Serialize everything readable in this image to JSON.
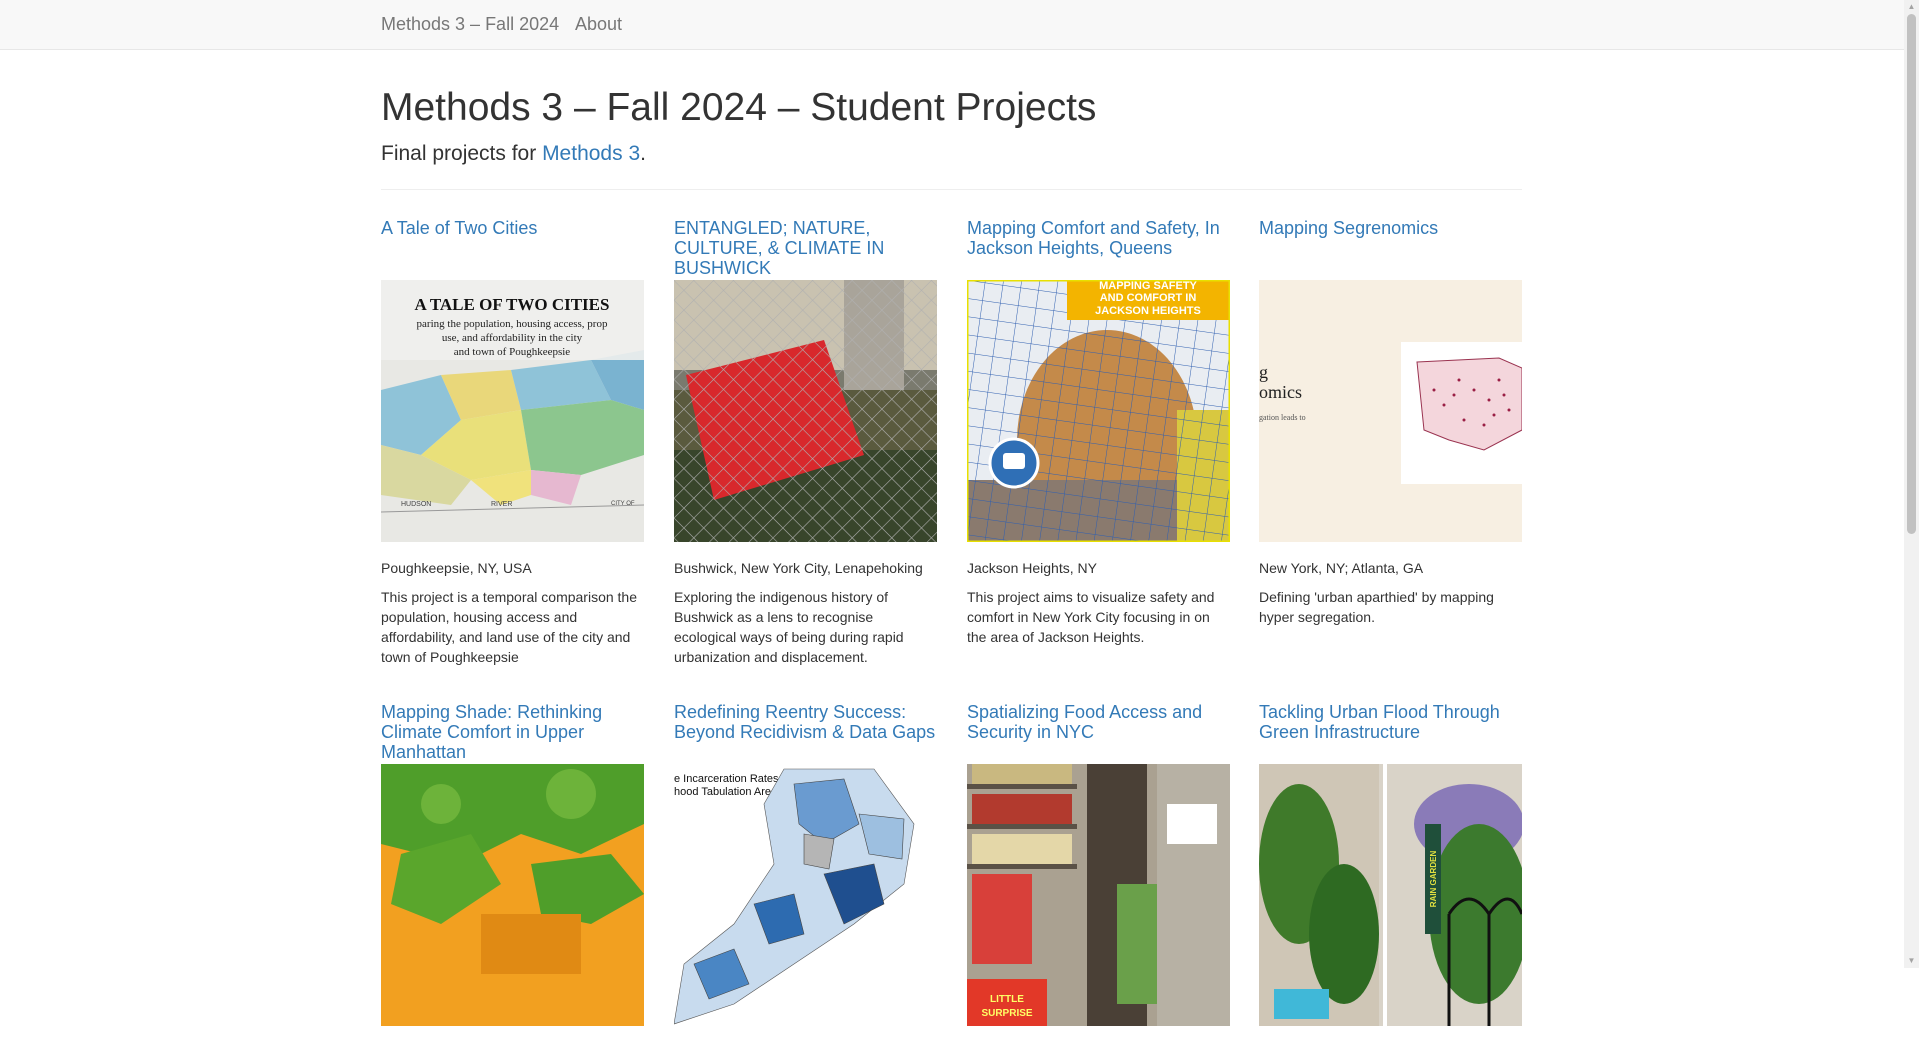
{
  "nav": {
    "brand": "Methods 3 – Fall 2024",
    "about": "About"
  },
  "header": {
    "title": "Methods 3 – Fall 2024 – Student Projects",
    "lead_prefix": "Final projects for ",
    "lead_link": "Methods 3",
    "lead_suffix": "."
  },
  "projects": [
    {
      "title": "A Tale of Two Cities",
      "location": "Poughkeepsie, NY, USA",
      "description": "This project is a temporal comparison the population, housing access and affordability, and land use of the city and town of Poughkeepsie",
      "image": {
        "heading": "A TALE OF TWO CITIES",
        "sub1": "paring the population, housing access, prop",
        "sub2": "use, and affordability in the city",
        "sub3": "and town of Poughkeepsie",
        "map_label1": "HUDSON",
        "map_label2": "RIVER",
        "map_label3": "CITY OF"
      }
    },
    {
      "title": "ENTANGLED; NATURE, CULTURE, & CLIMATE IN BUSHWICK",
      "location": "Bushwick, New York City, Lenapehoking",
      "description": "Exploring the indigenous history of Bushwick as a lens to recognise ecological ways of being during rapid urbanization and displacement.",
      "image": {}
    },
    {
      "title": "Mapping Comfort and Safety, In Jackson Heights, Queens",
      "location": "Jackson Heights, NY",
      "description": "This project aims to visualize safety and comfort in New York City focusing in on the area of Jackson Heights.",
      "image": {
        "banner1": "MAPPING SAFETY",
        "banner2": "AND COMFORT IN",
        "banner3": "JACKSON HEIGHTS"
      }
    },
    {
      "title": "Mapping Segrenomics",
      "location": "New York, NY; Atlanta, GA",
      "description": "Defining 'urban aparthied' by mapping hyper segregation.",
      "image": {
        "text1": "g",
        "text2": "omics",
        "text3": "gation leads to"
      }
    },
    {
      "title": "Mapping Shade: Rethinking Climate Comfort in Upper Manhattan",
      "location": "",
      "description": "",
      "image": {}
    },
    {
      "title": "Redefining Reentry Success: Beyond Recidivism & Data Gaps",
      "location": "",
      "description": "",
      "image": {
        "text1": "e Incarceration Rates by",
        "text2": "hood Tabulation Areas"
      }
    },
    {
      "title": "Spatializing Food Access and Security in NYC",
      "location": "",
      "description": "",
      "image": {
        "sign1": "LITTLE",
        "sign2": "SURPRISE"
      }
    },
    {
      "title": "Tackling Urban Flood Through Green Infrastructure",
      "location": "",
      "description": "",
      "image": {
        "sign": "RAIN GARDEN"
      }
    }
  ],
  "colors": {
    "link": "#337ab7",
    "text": "#333333",
    "nav_text": "#777777",
    "nav_bg": "#f8f8f8"
  }
}
